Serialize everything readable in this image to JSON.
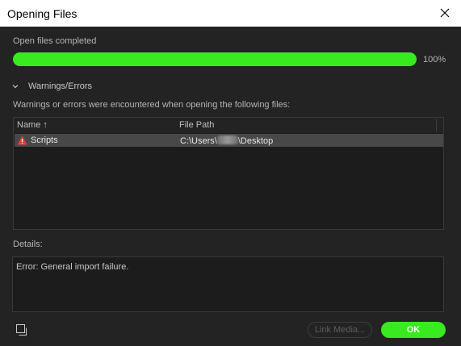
{
  "window": {
    "title": "Opening Files"
  },
  "progress": {
    "label": "Open files completed",
    "percent_text": "100%",
    "fraction": 1.0
  },
  "warnings": {
    "section_title": "Warnings/Errors",
    "description": "Warnings or errors were encountered when opening the following files:",
    "columns": {
      "name": "Name",
      "sort_indicator": "↑",
      "path": "File Path"
    },
    "rows": [
      {
        "name": "Scripts",
        "path_prefix": "C:\\Users\\",
        "path_suffix": "\\Desktop",
        "status_icon": "warning-icon"
      }
    ]
  },
  "details": {
    "label": "Details:",
    "text": "Error: General import failure."
  },
  "buttons": {
    "link_media": "Link Media...",
    "ok": "OK"
  },
  "colors": {
    "accent": "#38ea1f",
    "background": "#232323",
    "warning": "#e3403b"
  }
}
